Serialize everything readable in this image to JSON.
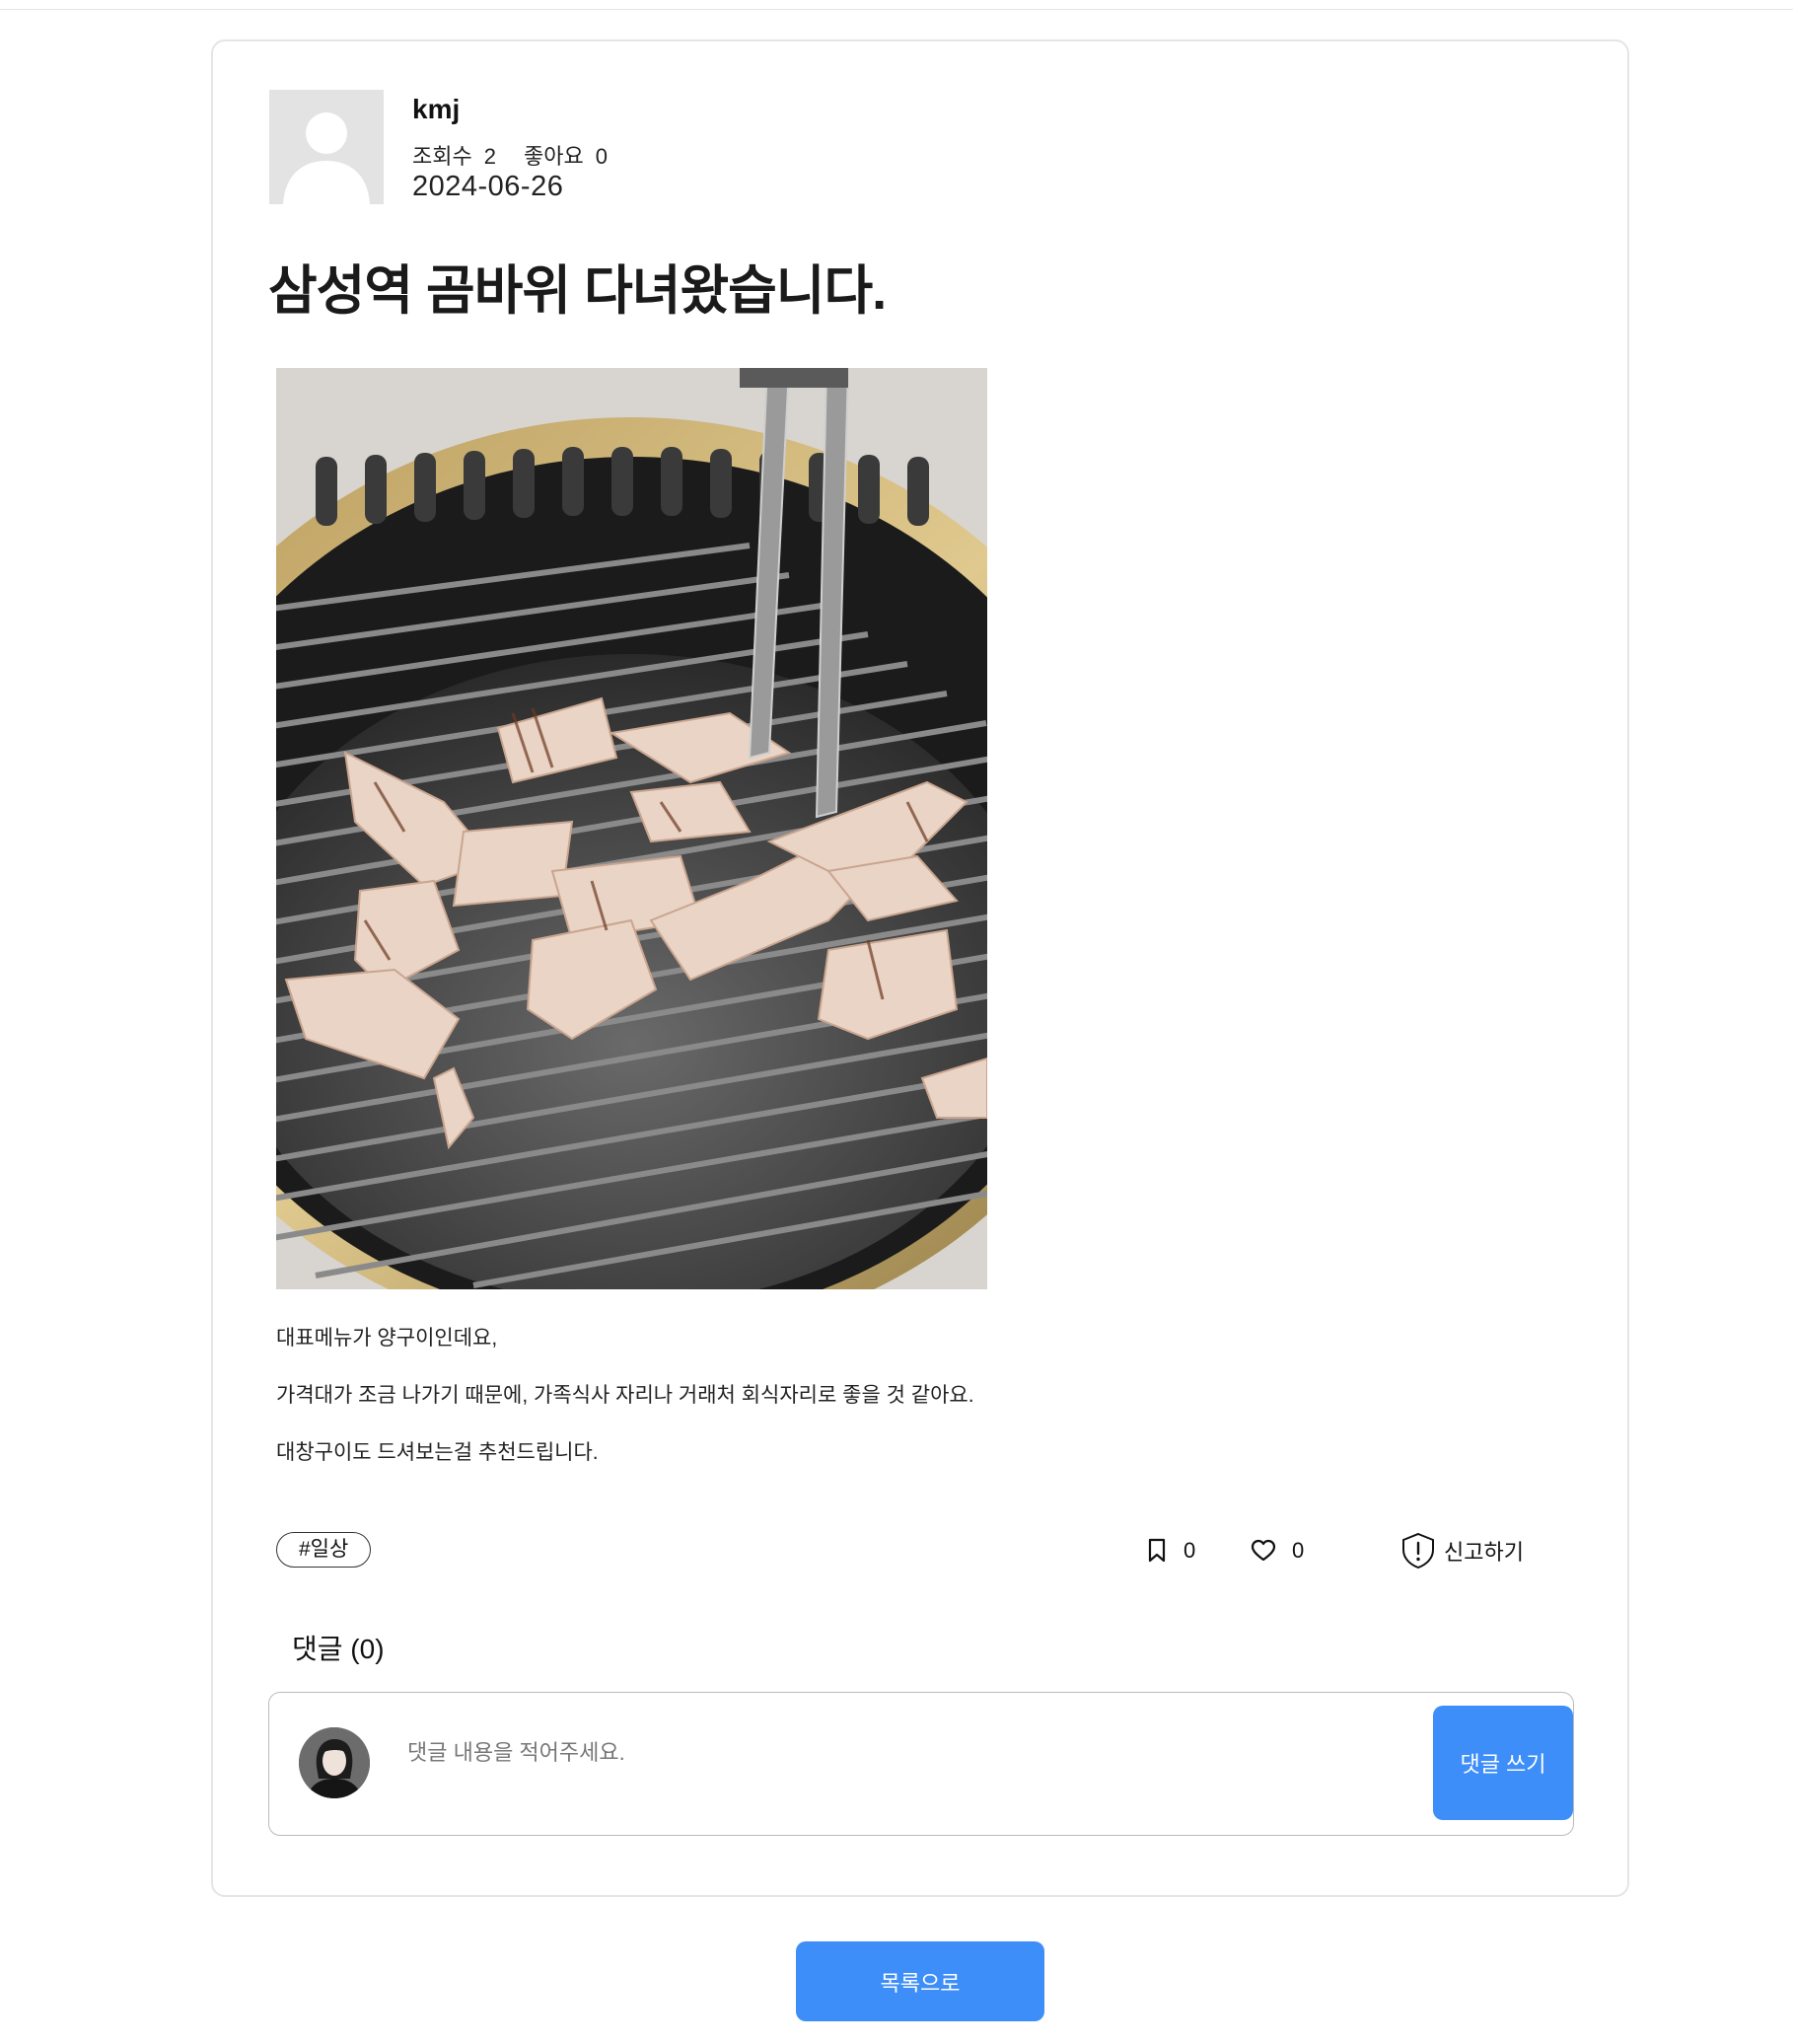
{
  "post": {
    "author": "kmj",
    "views_label": "조회수",
    "views": "2",
    "likes_label": "좋아요",
    "likes": "0",
    "date": "2024-06-26",
    "title": "삼성역 곰바위 다녀왔습니다.",
    "body": [
      "대표메뉴가 양구이인데요,",
      "가격대가 조금 나가기 때문에, 가족식사 자리나 거래처 회식자리로 좋을 것 같아요.",
      "대창구이도 드셔보는걸 추천드립니다."
    ],
    "tag": "#일상",
    "bookmark_count": "0",
    "like_count": "0",
    "report_label": "신고하기"
  },
  "comments": {
    "title": "댓글 (0)",
    "placeholder": "댓글 내용을 적어주세요.",
    "submit_label": "댓글 쓰기"
  },
  "footer": {
    "list_label": "목록으로"
  },
  "icons": {
    "bookmark": "bookmark-icon",
    "like": "heart-icon",
    "report": "shield-alert-icon"
  },
  "colors": {
    "accent": "#3d8ef8",
    "card_border": "#e5e5e5"
  }
}
